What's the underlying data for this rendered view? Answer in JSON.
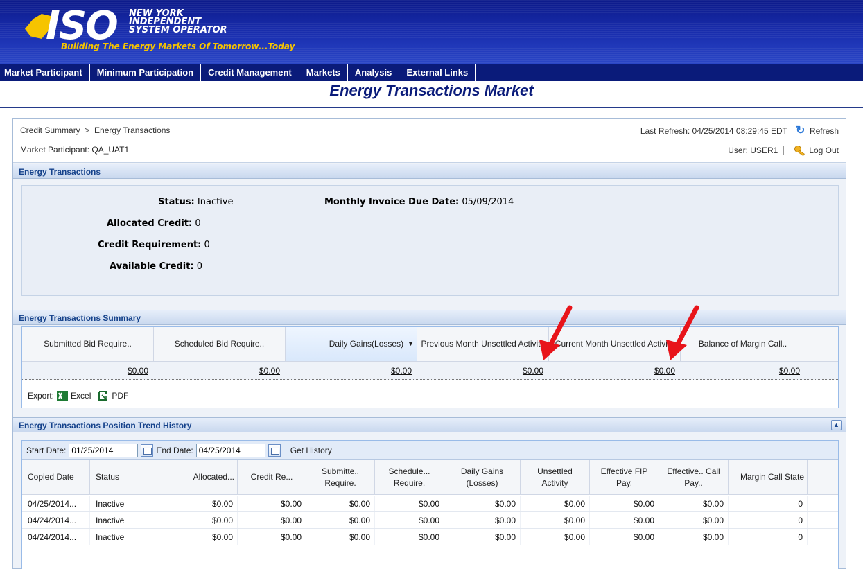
{
  "header": {
    "logo_big": "ISO",
    "logo_line1": "NEW YORK",
    "logo_line2": "INDEPENDENT",
    "logo_line3": "SYSTEM OPERATOR",
    "tagline": "Building The Energy Markets Of Tomorrow...Today"
  },
  "nav": [
    "Market Participant",
    "Minimum Participation",
    "Credit Management",
    "Markets",
    "Analysis",
    "External Links"
  ],
  "page_title": "Energy Transactions Market",
  "topbar": {
    "crumb_parent": "Credit Summary",
    "crumb_sep": ">",
    "crumb_current": "Energy Transactions",
    "market_participant": "Market Participant: QA_UAT1",
    "last_refresh": "Last Refresh: 04/25/2014 08:29:45 EDT",
    "refresh_label": "Refresh",
    "user": "User: USER1",
    "logout_label": "Log Out"
  },
  "energy_transactions": {
    "title": "Energy Transactions",
    "status_label": "Status:",
    "status_value": "Inactive",
    "allocated_label": "Allocated Credit:",
    "allocated_value": "0",
    "requirement_label": "Credit Requirement:",
    "requirement_value": "0",
    "available_label": "Available Credit:",
    "available_value": "0",
    "due_label": "Monthly Invoice Due Date:",
    "due_value": "05/09/2014"
  },
  "summary": {
    "title": "Energy Transactions Summary",
    "columns": [
      "Submitted Bid Require..",
      "Scheduled Bid Require..",
      "Daily Gains(Losses)",
      "Previous Month Unsettled Activity",
      "Current Month Unsettled Activity",
      "Balance of Margin Call.."
    ],
    "values": [
      "$0.00",
      "$0.00",
      "$0.00",
      "$0.00",
      "$0.00",
      "$0.00"
    ],
    "export_label": "Export:",
    "excel_label": "Excel",
    "pdf_label": "PDF"
  },
  "history": {
    "title": "Energy Transactions Position Trend History",
    "start_label": "Start Date:",
    "start_value": "01/25/2014",
    "end_label": "End Date:",
    "end_value": "04/25/2014",
    "get_history_label": "Get History",
    "columns": [
      "Copied Date",
      "Status",
      "Allocated...",
      "Credit Re...",
      "Submitte.. Require.",
      "Schedule... Require.",
      "Daily Gains (Losses)",
      "Unsettled Activity",
      "Effective FIP Pay.",
      "Effective.. Call Pay..",
      "Margin Call State"
    ],
    "rows": [
      [
        "04/25/2014...",
        "Inactive",
        "$0.00",
        "$0.00",
        "$0.00",
        "$0.00",
        "$0.00",
        "$0.00",
        "$0.00",
        "$0.00",
        "0"
      ],
      [
        "04/24/2014...",
        "Inactive",
        "$0.00",
        "$0.00",
        "$0.00",
        "$0.00",
        "$0.00",
        "$0.00",
        "$0.00",
        "$0.00",
        "0"
      ],
      [
        "04/24/2014...",
        "Inactive",
        "$0.00",
        "$0.00",
        "$0.00",
        "$0.00",
        "$0.00",
        "$0.00",
        "$0.00",
        "$0.00",
        "0"
      ]
    ]
  },
  "colors": {
    "nav_bg": "#0a1b7a",
    "title_color": "#0a1b7a",
    "panel_title": "#15428b",
    "arrow": "#e8141a"
  }
}
